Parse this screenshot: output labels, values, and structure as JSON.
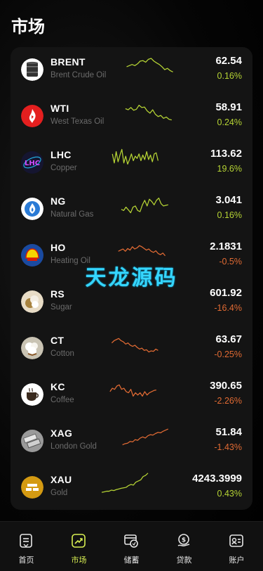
{
  "header": {
    "title": "市场"
  },
  "watermark": "天龙源码",
  "markets": [
    {
      "symbol": "BRENT",
      "name": "Brent Crude Oil",
      "price": "62.54",
      "change": "0.16%",
      "direction": "up",
      "icon": "oil-barrel-icon",
      "spark": [
        0.55,
        0.5,
        0.45,
        0.5,
        0.42,
        0.3,
        0.28,
        0.35,
        0.22,
        0.18,
        0.3,
        0.38,
        0.45,
        0.55,
        0.68,
        0.62,
        0.72,
        0.78
      ]
    },
    {
      "symbol": "WTI",
      "name": "West Texas Oil",
      "price": "58.91",
      "change": "0.24%",
      "direction": "up",
      "icon": "fire-drop-icon",
      "spark": [
        0.35,
        0.4,
        0.3,
        0.42,
        0.38,
        0.2,
        0.3,
        0.28,
        0.45,
        0.55,
        0.4,
        0.6,
        0.7,
        0.65,
        0.78,
        0.72,
        0.82,
        0.85
      ]
    },
    {
      "symbol": "LHC",
      "name": "Copper",
      "price": "113.62",
      "change": "19.6%",
      "direction": "up",
      "icon": "lhc-logo-icon",
      "spark": [
        0.3,
        0.7,
        0.2,
        0.65,
        0.35,
        0.1,
        0.7,
        0.4,
        0.75,
        0.55,
        0.3,
        0.6,
        0.4,
        0.5,
        0.3,
        0.6,
        0.35,
        0.55,
        0.2,
        0.55,
        0.35,
        0.65,
        0.3,
        0.25,
        0.6
      ]
    },
    {
      "symbol": "NG",
      "name": "Natural Gas",
      "price": "3.041",
      "change": "0.16%",
      "direction": "up",
      "icon": "gas-flame-icon",
      "spark": [
        0.7,
        0.75,
        0.6,
        0.72,
        0.85,
        0.6,
        0.55,
        0.75,
        0.8,
        0.5,
        0.3,
        0.55,
        0.25,
        0.35,
        0.5,
        0.3,
        0.2,
        0.45,
        0.55,
        0.52,
        0.5
      ]
    },
    {
      "symbol": "HO",
      "name": "Heating Oil",
      "price": "2.1831",
      "change": "-0.5%",
      "direction": "down",
      "icon": "shell-logo-icon",
      "spark": [
        0.5,
        0.45,
        0.4,
        0.5,
        0.38,
        0.45,
        0.3,
        0.4,
        0.35,
        0.25,
        0.3,
        0.38,
        0.45,
        0.4,
        0.5,
        0.55,
        0.48,
        0.6,
        0.65,
        0.58,
        0.7
      ]
    },
    {
      "symbol": "RS",
      "name": "Sugar",
      "price": "601.92",
      "change": "-16.4%",
      "direction": "down",
      "icon": "sugar-icon",
      "spark": []
    },
    {
      "symbol": "CT",
      "name": "Cotton",
      "price": "63.67",
      "change": "-0.25%",
      "direction": "down",
      "icon": "cotton-icon",
      "spark": [
        0.45,
        0.35,
        0.3,
        0.25,
        0.35,
        0.4,
        0.5,
        0.45,
        0.55,
        0.6,
        0.55,
        0.65,
        0.72,
        0.68,
        0.78,
        0.75,
        0.85,
        0.8,
        0.82,
        0.72,
        0.78
      ]
    },
    {
      "symbol": "KC",
      "name": "Coffee",
      "price": "390.65",
      "change": "-2.26%",
      "direction": "down",
      "icon": "coffee-cup-icon",
      "spark": [
        0.55,
        0.4,
        0.45,
        0.3,
        0.25,
        0.45,
        0.4,
        0.55,
        0.6,
        0.45,
        0.75,
        0.6,
        0.7,
        0.6,
        0.75,
        0.55,
        0.7,
        0.6,
        0.55,
        0.5,
        0.48
      ]
    },
    {
      "symbol": "XAG",
      "name": "London Gold",
      "price": "51.84",
      "change": "-1.43%",
      "direction": "down",
      "icon": "silver-bars-icon",
      "spark": [
        0.85,
        0.8,
        0.78,
        0.7,
        0.72,
        0.62,
        0.65,
        0.55,
        0.5,
        0.55,
        0.45,
        0.4,
        0.42,
        0.35,
        0.3,
        0.32,
        0.25,
        0.2,
        0.15
      ]
    },
    {
      "symbol": "XAU",
      "name": "Gold",
      "price": "4243.3999",
      "change": "0.43%",
      "direction": "up",
      "icon": "gold-bars-icon",
      "spark": [
        0.9,
        0.88,
        0.85,
        0.85,
        0.8,
        0.82,
        0.78,
        0.75,
        0.72,
        0.7,
        0.68,
        0.6,
        0.55,
        0.58,
        0.45,
        0.4,
        0.35,
        0.2,
        0.15,
        0.05
      ]
    }
  ],
  "tabbar": [
    {
      "label": "首页",
      "icon": "home-icon",
      "active": false
    },
    {
      "label": "市场",
      "icon": "market-chart-icon",
      "active": true
    },
    {
      "label": "储蓄",
      "icon": "savings-icon",
      "active": false
    },
    {
      "label": "贷款",
      "icon": "loan-icon",
      "active": false
    },
    {
      "label": "账户",
      "icon": "account-icon",
      "active": false
    }
  ],
  "colors": {
    "up": "#b5d334",
    "down": "#e06a33",
    "accent": "#d8ef52"
  }
}
